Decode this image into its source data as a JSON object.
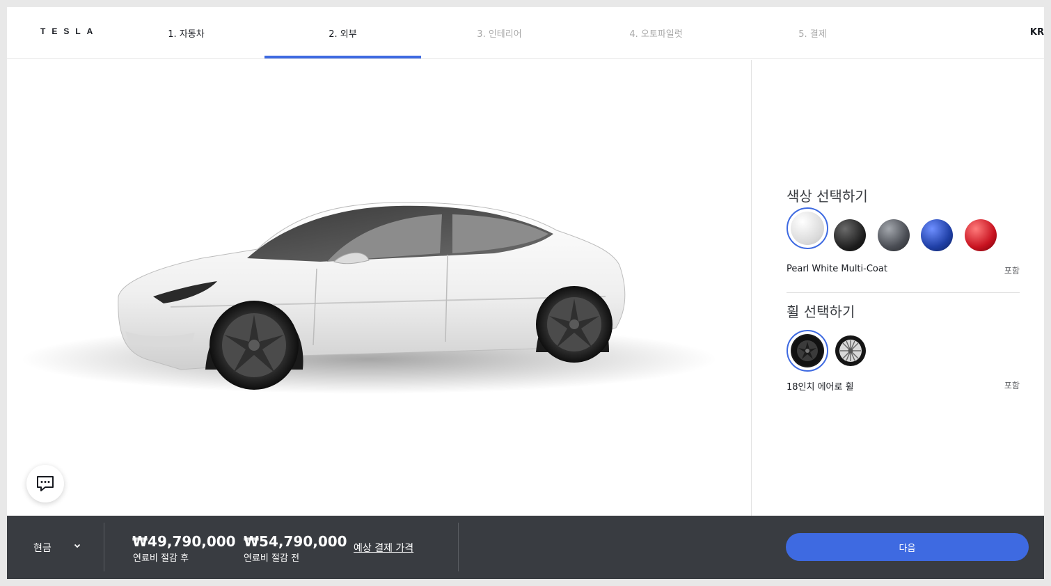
{
  "header": {
    "logo": "TESLA",
    "tabs": [
      {
        "label": "1. 자동차",
        "state": "done"
      },
      {
        "label": "2. 외부",
        "state": "active"
      },
      {
        "label": "3. 인테리어",
        "state": "future"
      },
      {
        "label": "4. 오토파일럿",
        "state": "future"
      },
      {
        "label": "5. 결제",
        "state": "future"
      }
    ],
    "lang": "KR"
  },
  "panel": {
    "color": {
      "title": "색상 선택하기",
      "swatches": [
        {
          "name": "pearl-white",
          "color": "#e9e9e9",
          "selected": true
        },
        {
          "name": "solid-black",
          "color": "#1c1c1c",
          "selected": false
        },
        {
          "name": "midnight-silver",
          "color": "#4a4d54",
          "selected": false
        },
        {
          "name": "deep-blue",
          "color": "#1f3fa6",
          "selected": false
        },
        {
          "name": "red",
          "color": "#c81320",
          "selected": false
        }
      ],
      "selected_label": "Pearl White Multi-Coat",
      "price": "포함"
    },
    "wheel": {
      "title": "휠 선택하기",
      "options": [
        {
          "name": "aero-wheel",
          "selected": true
        },
        {
          "name": "sport-wheel",
          "selected": false
        }
      ],
      "selected_label": "18인치 에어로 휠",
      "price": "포함"
    }
  },
  "footer": {
    "payment_method": "현금",
    "price_after": "₩49,790,000",
    "price_after_label": "연료비 절감 후",
    "price_before": "₩54,790,000",
    "price_before_label": "연료비 절감 전",
    "estimate_link": "예상 결제 가격",
    "next_label": "다음"
  },
  "colors": {
    "accent": "#3e6ae1",
    "footer_bg": "#393c41"
  }
}
